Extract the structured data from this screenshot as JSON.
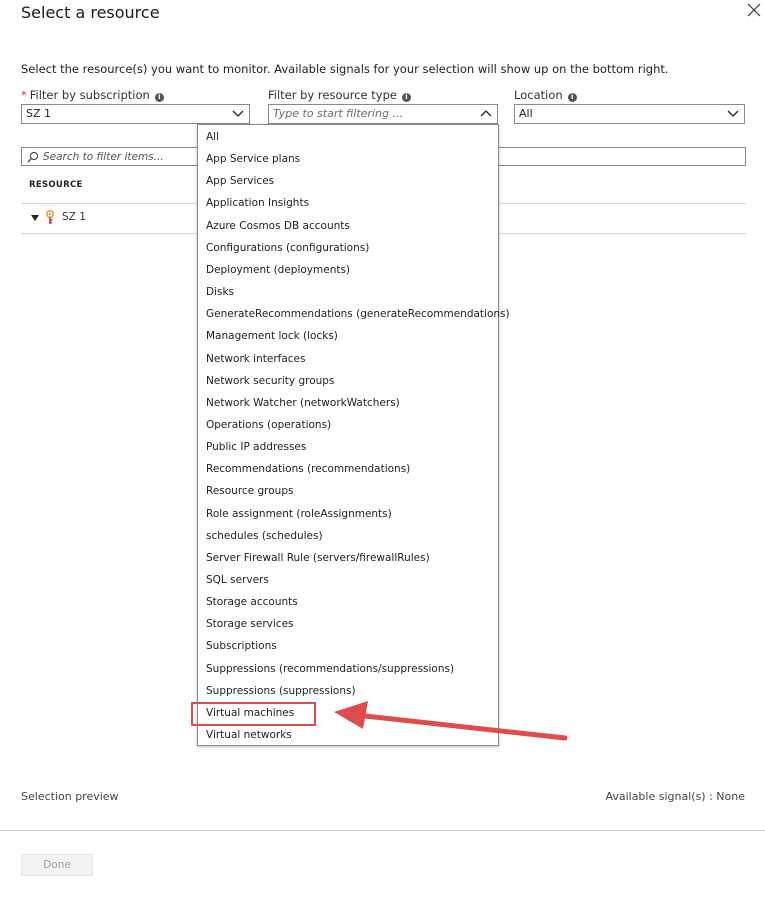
{
  "panel": {
    "title": "Select a resource",
    "instruction": "Select the resource(s) you want to monitor. Available signals for your selection will show up on the bottom right."
  },
  "filters": {
    "subscription": {
      "required_marker": "*",
      "label": "Filter by subscription",
      "value": "SZ 1"
    },
    "resource_type": {
      "label": "Filter by resource type",
      "placeholder": "Type to start filtering ..."
    },
    "location": {
      "label": "Location",
      "value": "All"
    }
  },
  "search": {
    "placeholder": "Search to filter items..."
  },
  "table": {
    "column_header": "RESOURCE",
    "rows": [
      {
        "label": "SZ 1"
      }
    ]
  },
  "dropdown_options": [
    "All",
    "App Service plans",
    "App Services",
    "Application Insights",
    "Azure Cosmos DB accounts",
    "Configurations (configurations)",
    "Deployment (deployments)",
    "Disks",
    "GenerateRecommendations (generateRecommendations)",
    "Management lock (locks)",
    "Network interfaces",
    "Network security groups",
    "Network Watcher (networkWatchers)",
    "Operations (operations)",
    "Public IP addresses",
    "Recommendations (recommendations)",
    "Resource groups",
    "Role assignment (roleAssignments)",
    "schedules (schedules)",
    "Server Firewall Rule (servers/firewallRules)",
    "SQL servers",
    "Storage accounts",
    "Storage services",
    "Subscriptions",
    "Suppressions (recommendations/suppressions)",
    "Suppressions (suppressions)",
    "Virtual machines",
    "Virtual networks"
  ],
  "highlighted_option": "Virtual machines",
  "footer": {
    "selection_preview": "Selection preview",
    "available_signals": "Available signal(s) : None",
    "done_label": "Done"
  },
  "colors": {
    "annotation_red": "#e24b4b",
    "required_red": "#d13438",
    "disabled_button": "#f2f2f2"
  },
  "icons": {
    "close": "close-icon",
    "info": "info-icon",
    "chevron_down": "chevron-down-icon",
    "chevron_up": "chevron-up-icon",
    "search": "search-icon",
    "expand": "expand-triangle-icon",
    "subscription": "subscription-key-icon",
    "annotation_arrow": "annotation-arrow-icon"
  }
}
